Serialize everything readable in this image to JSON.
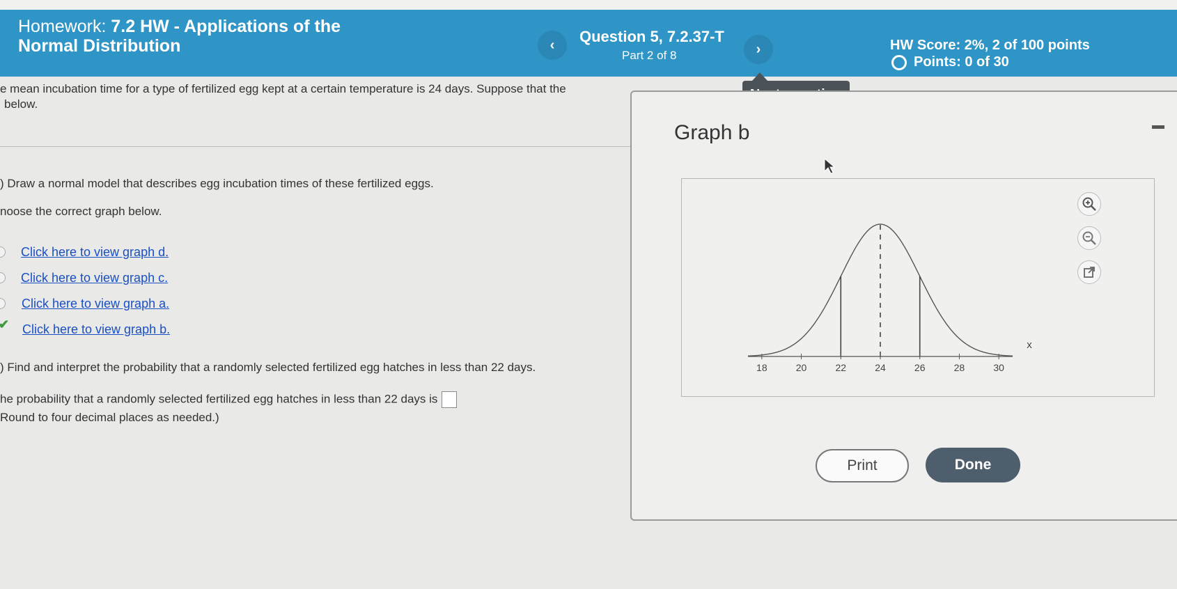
{
  "header": {
    "hw_label": "Homework:",
    "hw_title_line1": "7.2 HW - Applications of the",
    "hw_title_line2": "Normal Distribution",
    "prev_symbol": "‹",
    "next_symbol": "›",
    "question_title": "Question 5, 7.2.37-T",
    "question_part": "Part 2 of 8",
    "hw_score": "HW Score: 2%, 2 of 100 points",
    "points": "Points: 0 of 30"
  },
  "tooltip": {
    "label": "Next question"
  },
  "question": {
    "intro_line1": "e mean incubation time for a type of fertilized egg kept at a certain temperature is 24 days. Suppose that the",
    "intro_line2": "below.",
    "part_a_prompt": ") Draw a normal model that describes egg incubation times of these fertilized eggs.",
    "choose_prompt": "noose the correct graph below.",
    "options": [
      {
        "label": "Click here to view graph d.",
        "selected": false
      },
      {
        "label": "Click here to view graph c.",
        "selected": false
      },
      {
        "label": "Click here to view graph a.",
        "selected": false
      },
      {
        "label": "Click here to view graph b.",
        "selected": true
      }
    ],
    "part_b_prompt": ") Find and interpret the probability that a randomly selected fertilized egg hatches in less than 22 days.",
    "answer_line": "he probability that a randomly selected fertilized egg hatches in less than 22 days is",
    "answer_value": "",
    "round_note": "Round to four decimal places as needed.)"
  },
  "dialog": {
    "title": "Graph b",
    "print_label": "Print",
    "done_label": "Done"
  },
  "chart_data": {
    "type": "line",
    "title": "",
    "xlabel": "x",
    "ylabel": "",
    "distribution": "normal",
    "mean": 24,
    "sd": 2,
    "x_ticks": [
      18,
      20,
      22,
      24,
      26,
      28,
      30
    ],
    "xlim": [
      17.3,
      30.7
    ],
    "vertical_lines": [
      {
        "x": 22,
        "style": "solid"
      },
      {
        "x": 24,
        "style": "dashed"
      },
      {
        "x": 26,
        "style": "solid"
      }
    ]
  },
  "colors": {
    "header_bg": "#2f95c6",
    "link": "#1a4fc4",
    "done_bg": "#4f5e6d",
    "tooltip_bg": "#4c5358",
    "check": "#3c9a3c"
  }
}
